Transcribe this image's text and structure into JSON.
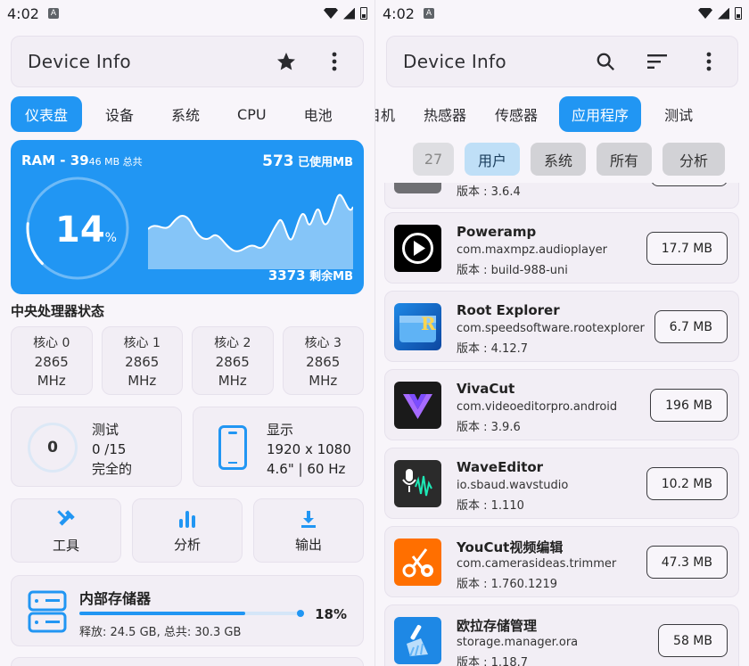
{
  "status": {
    "time": "4:02",
    "a_icon": "A"
  },
  "left": {
    "title": "Device Info",
    "tabs": [
      "仪表盘",
      "设备",
      "系统",
      "CPU",
      "电池"
    ],
    "ram": {
      "label": "RAM - 39",
      "total_small": "46 MB 总共",
      "used_num": "573",
      "used_unit": " 已使用MB",
      "percent": "14",
      "percent_unit": "%",
      "percent_value": 14,
      "free_num": "3373",
      "free_unit": " 剩余MB"
    },
    "cpu_title": "中央处理器状态",
    "cores": [
      {
        "label": "核心 0",
        "freq": "2865",
        "unit": "MHz"
      },
      {
        "label": "核心 1",
        "freq": "2865",
        "unit": "MHz"
      },
      {
        "label": "核心 2",
        "freq": "2865",
        "unit": "MHz"
      },
      {
        "label": "核心 3",
        "freq": "2865",
        "unit": "MHz"
      }
    ],
    "test": {
      "count": "0",
      "title": "测试",
      "progress": "0 /15",
      "status": "完全的"
    },
    "display": {
      "title": "显示",
      "resolution": "1920 x 1080",
      "spec": "4.6\" | 60 Hz"
    },
    "tools": [
      {
        "label": "工具"
      },
      {
        "label": "分析"
      },
      {
        "label": "输出"
      }
    ],
    "storage": {
      "name": "内部存储器",
      "percent": "18%",
      "fill_fraction": 0.75,
      "detail": "释放: 24.5 GB, 总共: 30.3 GB"
    }
  },
  "right": {
    "title": "Device Info",
    "tabs": [
      "目机",
      "热感器",
      "传感器",
      "应用程序",
      "测试"
    ],
    "filters": [
      "27",
      "用户",
      "系统",
      "所有",
      "分析"
    ],
    "partial_version": "版本 : 3.6.4",
    "apps": [
      {
        "name": "Poweramp",
        "package": "com.maxmpz.audioplayer",
        "version": "版本 : build-988-uni",
        "size": "17.7 MB",
        "icon": "poweramp-icon"
      },
      {
        "name": "Root Explorer",
        "package": "com.speedsoftware.rootexplorer",
        "version": "版本 : 4.12.7",
        "size": "6.7 MB",
        "icon": "root-explorer-icon"
      },
      {
        "name": "VivaCut",
        "package": "com.videoeditorpro.android",
        "version": "版本 : 3.9.6",
        "size": "196 MB",
        "icon": "vivacut-icon"
      },
      {
        "name": "WaveEditor",
        "package": "io.sbaud.wavstudio",
        "version": "版本 : 1.110",
        "size": "10.2 MB",
        "icon": "waveeditor-icon"
      },
      {
        "name": "YouCut视频编辑",
        "package": "com.camerasideas.trimmer",
        "version": "版本 : 1.760.1219",
        "size": "47.3 MB",
        "icon": "youcut-icon"
      },
      {
        "name": "欧拉存储管理",
        "package": "storage.manager.ora",
        "version": "版本 : 1.18.7",
        "size": "58 MB",
        "icon": "storage-manager-icon"
      }
    ]
  },
  "colors": {
    "accent": "#2196f3",
    "surface": "#f2eef5",
    "background": "#f8f5fa"
  }
}
